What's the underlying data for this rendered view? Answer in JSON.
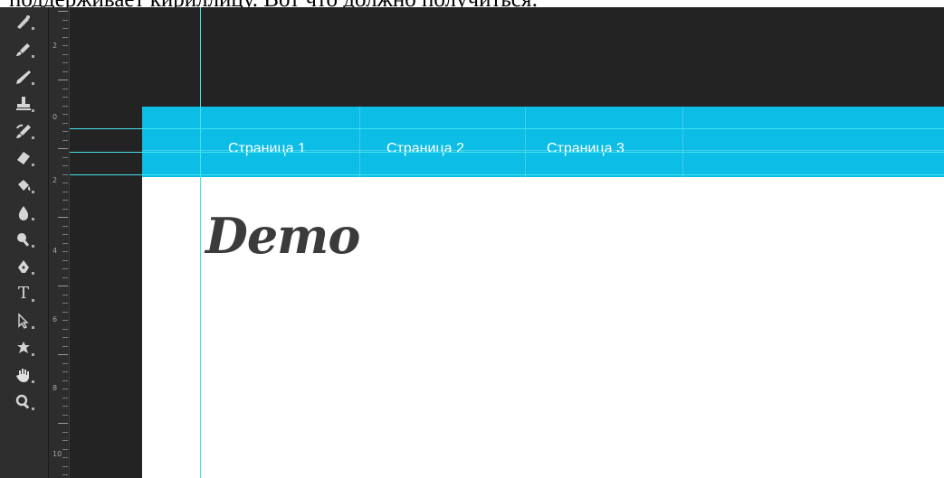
{
  "caption": {
    "text": "поддерживает кириллицу. Вот что должно получиться:"
  },
  "toolbar": {
    "tools": [
      {
        "icon": "spot-healing-icon"
      },
      {
        "icon": "brush-icon"
      },
      {
        "icon": "pencil-icon"
      },
      {
        "icon": "clone-stamp-icon"
      },
      {
        "icon": "history-brush-icon"
      },
      {
        "icon": "eraser-icon"
      },
      {
        "icon": "paint-bucket-icon"
      },
      {
        "icon": "blur-icon"
      },
      {
        "icon": "dodge-icon"
      },
      {
        "icon": "pen-icon"
      },
      {
        "icon": "type-icon",
        "glyph": "T"
      },
      {
        "icon": "path-selection-icon"
      },
      {
        "icon": "custom-shape-icon"
      },
      {
        "icon": "hand-icon"
      },
      {
        "icon": "zoom-icon"
      }
    ]
  },
  "ruler": {
    "labels": [
      "2",
      "0",
      "2",
      "4",
      "6",
      "8",
      "10"
    ]
  },
  "document": {
    "nav": {
      "items": [
        "Страница 1",
        "Страница 2",
        "Страница 3"
      ],
      "background": "#0cbde6",
      "text_color": "#ffffff"
    },
    "logo_text": "Demo",
    "guide_color": "#44e2ec"
  }
}
